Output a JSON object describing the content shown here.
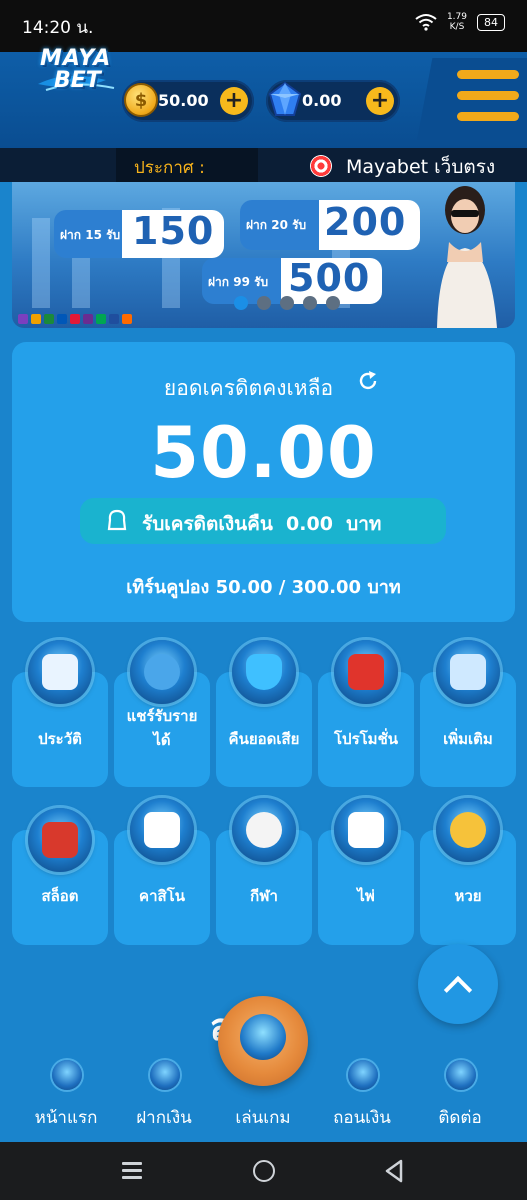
{
  "status_bar": {
    "time": "14:20 น.",
    "net_speed_value": "1.79",
    "net_speed_unit": "K/S",
    "battery": "84"
  },
  "header": {
    "logo_line1": "MAYA",
    "logo_line2": "BET",
    "coin_balance": "50.00",
    "gem_balance": "0.00",
    "icons": [
      "coin-icon",
      "gem-icon",
      "plus-icon",
      "hamburger-menu-icon"
    ]
  },
  "announcement": {
    "label": "ประกาศ :",
    "text": "Mayabet เว็บตรง"
  },
  "banner": {
    "offers": [
      {
        "deposit": "ฝาก 15 รับ",
        "bonus": "150"
      },
      {
        "deposit": "ฝาก 20 รับ",
        "bonus": "200"
      },
      {
        "deposit": "ฝาก 99 รับ",
        "bonus": "500"
      }
    ],
    "slide_count": 5,
    "active_slide": 1
  },
  "credit": {
    "title": "ยอดเครดิตคงเหลือ",
    "amount": "50.00",
    "cashback_label": "รับเครดิตเงินคืน",
    "cashback_value": "0.00",
    "cashback_unit": "บาท",
    "turnover": "เทิร์นคูปอง 50.00 / 300.00 บาท"
  },
  "menu_row1": [
    {
      "label": "ประวัติ",
      "icon": "history-profile-icon"
    },
    {
      "label": "แชร์รับราย",
      "label2": "ได้",
      "icon": "share-income-icon"
    },
    {
      "label": "คืนยอดเสีย",
      "icon": "cashback-shield-icon"
    },
    {
      "label": "โปรโมชั่น",
      "icon": "promotion-gift-icon"
    },
    {
      "label": "เพิ่มเติม",
      "icon": "more-plus-icon"
    }
  ],
  "menu_row2": [
    {
      "label": "สล็อต",
      "icon": "slot-machine-icon"
    },
    {
      "label": "คาสิโน",
      "icon": "casino-cards-icon"
    },
    {
      "label": "กีฬา",
      "icon": "sports-ball-icon"
    },
    {
      "label": "ไพ่",
      "icon": "playing-cards-icon"
    },
    {
      "label": "หวย",
      "icon": "lottery-balls-icon"
    }
  ],
  "partial_heading": "สล็อต",
  "bottom_nav": [
    {
      "label": "หน้าแรก",
      "icon": "home-icon"
    },
    {
      "label": "ฝากเงิน",
      "icon": "deposit-icon"
    },
    {
      "label": "เล่นเกม",
      "icon": "play-game-icon"
    },
    {
      "label": "ถอนเงิน",
      "icon": "withdraw-icon"
    },
    {
      "label": "ติดต่อ",
      "icon": "contact-icon"
    }
  ],
  "colors": {
    "background": "#1a84cc",
    "card": "#24a0ea",
    "accent": "#f7b91c",
    "header": "#0a4d91"
  }
}
